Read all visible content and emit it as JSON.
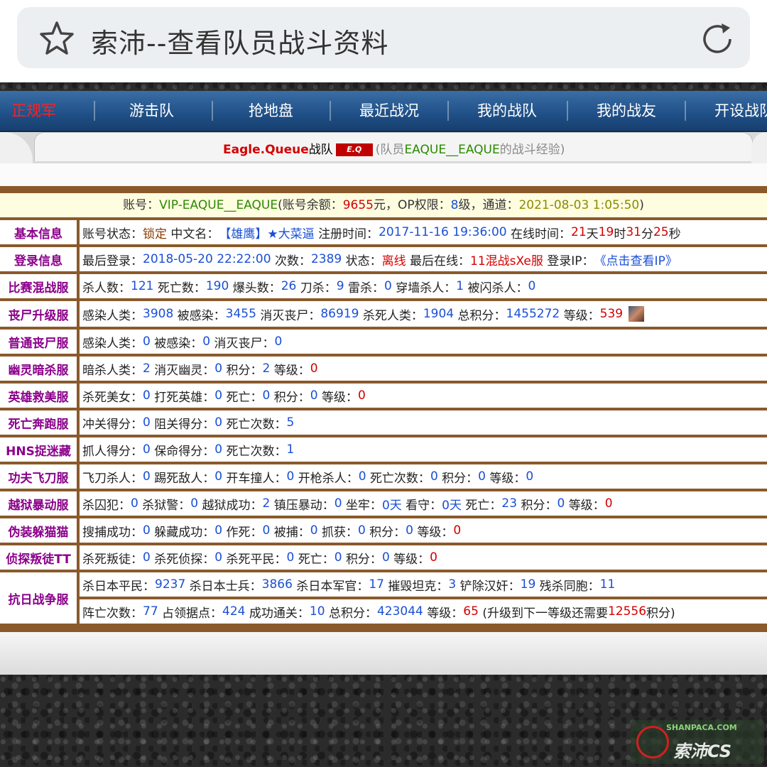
{
  "browser": {
    "title": "索沛--查看队员战斗资料",
    "star_icon": "star-icon",
    "reload_icon": "reload-icon"
  },
  "nav": {
    "items": [
      "正规军",
      "游击队",
      "抢地盘",
      "最近战况",
      "我的战队",
      "我的战友",
      "开设战队"
    ],
    "active_color": "#ff2020"
  },
  "subheader": {
    "team_name": "Eagle.Queue",
    "team_suffix": "战队",
    "badge_text": "E.Q",
    "member_prefix": "(队员",
    "member_name": "EAQUE__EAQUE",
    "member_suffix": "的战斗经验)"
  },
  "account": {
    "label_account": "账号：",
    "account": "VIP-EAQUE__EAQUE",
    "label_balance": "(账号余额：",
    "balance": "9655",
    "balance_unit": "元，OP权限：",
    "op_level": "8",
    "op_unit": "级，通道：",
    "timestamp": "2021-08-03 1:05:50",
    "close": ")"
  },
  "rows": {
    "basic": {
      "label": "基本信息",
      "status_label": "账号状态：",
      "status": "锁定",
      "cn_label": "中文名：",
      "cn_name": "【雄鹰】★大菜逼",
      "reg_label": "注册时间：",
      "reg_time": "2017-11-16 19:36:00",
      "online_label": "在线时间：",
      "days": "21",
      "days_unit": "天",
      "hours": "19",
      "hours_unit": "时",
      "mins": "31",
      "mins_unit": "分",
      "secs": "25",
      "secs_unit": "秒"
    },
    "login": {
      "label": "登录信息",
      "last_label": "最后登录：",
      "last_login": "2018-05-20 22:22:00",
      "count_label": "次数：",
      "count": "2389",
      "state_label": "状态：",
      "state": "离线",
      "last_online_label": "最后在线：",
      "last_online": "11混战sXe服",
      "ip_label": "登录IP：",
      "ip_link": "《点击查看IP》"
    },
    "match": {
      "label": "比赛混战服",
      "kills_label": "杀人数：",
      "kills": "121",
      "deaths_label": "死亡数：",
      "deaths": "190",
      "hs_label": "爆头数：",
      "hs": "26",
      "knife_label": "刀杀：",
      "knife": "9",
      "nade_label": "雷杀：",
      "nade": "0",
      "wall_label": "穿墙杀人：",
      "wall": "1",
      "flash_label": "被闪杀人：",
      "flash": "0"
    },
    "zombie_up": {
      "label": "丧尸升级服",
      "infect_label": "感染人类：",
      "infect": "3908",
      "infected_label": "被感染：",
      "infected": "3455",
      "destroy_label": "消灭丧尸：",
      "destroy": "86919",
      "killh_label": "杀死人类：",
      "killh": "1904",
      "total_label": "总积分：",
      "total": "1455272",
      "level_label": "等级：",
      "level": "539",
      "avatar_icon": "avatar-icon"
    },
    "zombie": {
      "label": "普通丧尸服",
      "infect_label": "感染人类：",
      "infect": "0",
      "infected_label": "被感染：",
      "infected": "0",
      "destroy_label": "消灭丧尸：",
      "destroy": "0"
    },
    "ghost": {
      "label": "幽灵暗杀服",
      "assassin_label": "暗杀人类：",
      "assassin": "2",
      "ghost_label": "消灭幽灵：",
      "ghost": "0",
      "score_label": "积分：",
      "score": "2",
      "level_label": "等级：",
      "level": "0"
    },
    "hero": {
      "label": "英雄救美服",
      "beauty_label": "杀死美女：",
      "beauty": "0",
      "hero_label": "打死英雄：",
      "hero": "0",
      "death_label": "死亡：",
      "death": "0",
      "score_label": "积分：",
      "score": "0",
      "level_label": "等级：",
      "level": "0"
    },
    "deathrun": {
      "label": "死亡奔跑服",
      "pass_label": "冲关得分：",
      "pass": "0",
      "block_label": "阻关得分：",
      "block": "0",
      "death_label": "死亡次数：",
      "death": "5"
    },
    "hns": {
      "label": "HNS捉迷藏",
      "catch_label": "抓人得分：",
      "catch": "0",
      "save_label": "保命得分：",
      "save": "0",
      "death_label": "死亡次数：",
      "death": "1"
    },
    "kungfu": {
      "label": "功夫飞刀服",
      "knife_label": "飞刀杀人：",
      "knife": "0",
      "kick_label": "踢死敌人：",
      "kick": "0",
      "car_label": "开车撞人：",
      "car": "0",
      "gun_label": "开枪杀人：",
      "gun": "0",
      "death_label": "死亡次数：",
      "death": "0",
      "score_label": "积分：",
      "score": "0",
      "level_label": "等级：",
      "level": "0"
    },
    "jail": {
      "label": "越狱暴动服",
      "prisoner_label": "杀囚犯：",
      "prisoner": "0",
      "guard_label": "杀狱警：",
      "guard": "0",
      "escape_label": "越狱成功：",
      "escape": "2",
      "riot_label": "镇压暴动：",
      "riot": "0",
      "jail_label": "坐牢：",
      "jail": "0天",
      "watch_label": "看守：",
      "watch": "0天",
      "death_label": "死亡：",
      "death": "23",
      "score_label": "积分：",
      "score": "0",
      "level_label": "等级：",
      "level": "0"
    },
    "prophunt": {
      "label": "伪装躲猫猫",
      "search_label": "搜捕成功：",
      "search": "0",
      "hide_label": "躲藏成功：",
      "hide": "0",
      "suicide_label": "作死：",
      "suicide": "0",
      "caught_label": "被捕：",
      "caught": "0",
      "catch_label": "抓获：",
      "catch": "0",
      "score_label": "积分：",
      "score": "0",
      "level_label": "等级：",
      "level": "0"
    },
    "ttt": {
      "label": "侦探叛徒TT",
      "traitor_label": "杀死叛徒：",
      "traitor": "0",
      "detective_label": "杀死侦探：",
      "detective": "0",
      "civilian_label": "杀死平民：",
      "civilian": "0",
      "death_label": "死亡：",
      "death": "0",
      "score_label": "积分：",
      "score": "0",
      "level_label": "等级：",
      "level": "0"
    },
    "war": {
      "label": "抗日战争服",
      "civ_label": "杀日本平民：",
      "civ": "9237",
      "soldier_label": "杀日本士兵：",
      "soldier": "3866",
      "officer_label": "杀日本军官：",
      "officer": "17",
      "tank_label": "摧毁坦克：",
      "tank": "3",
      "traitor_label": "铲除汉奸：",
      "traitor": "19",
      "tk_label": "残杀同胞：",
      "tk": "11",
      "death_label": "阵亡次数：",
      "death": "77",
      "base_label": "占领据点：",
      "base": "424",
      "clear_label": "成功通关：",
      "clear": "10",
      "total_label": "总积分：",
      "total": "423044",
      "level_label": "等级：",
      "level": "65",
      "next_prefix": "(升级到下一等级还需要",
      "next_need": "12556",
      "next_suffix": "积分)"
    }
  },
  "watermark": {
    "top": "SHANPACA.COM",
    "main": "索沛CS"
  }
}
